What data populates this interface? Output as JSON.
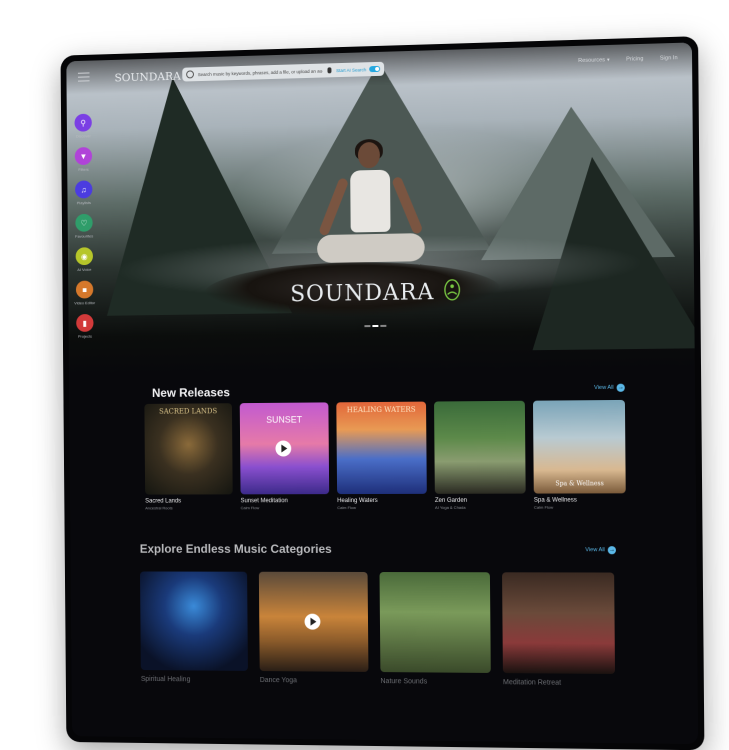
{
  "brand": {
    "name": "SOUNDARA"
  },
  "search": {
    "placeholder": "Search music by keywords, phrases, add a file, or upload an audio file",
    "ai_label": "Start AI Search"
  },
  "nav": {
    "resources": "Resources",
    "pricing": "Pricing",
    "sign_in": "Sign In"
  },
  "sidebar": {
    "items": [
      {
        "label": "Discover",
        "icon": "search-icon",
        "color": "#7b3fe4"
      },
      {
        "label": "Filters",
        "icon": "filter-icon",
        "color": "#b043d8"
      },
      {
        "label": "Playlists",
        "icon": "music-note-icon",
        "color": "#4b3ce0"
      },
      {
        "label": "Favourites",
        "icon": "heart-icon",
        "color": "#2f9d6a"
      },
      {
        "label": "AI Voice",
        "icon": "ai-voice-icon",
        "color": "#b6c62a"
      },
      {
        "label": "Video Editor",
        "icon": "video-editor-icon",
        "color": "#d5782b"
      },
      {
        "label": "Projects",
        "icon": "folder-icon",
        "color": "#d23a3a"
      }
    ]
  },
  "hero": {
    "logo_text": "SOUNDARA"
  },
  "new_releases": {
    "title": "New Releases",
    "view_all": "View All",
    "items": [
      {
        "title": "Sacred Lands",
        "subtitle": "Ancestral Roots",
        "art_text": "SACRED LANDS"
      },
      {
        "title": "Sunset Meditation",
        "subtitle": "Calm Flow",
        "art_text": "SUNSET"
      },
      {
        "title": "Healing Waters",
        "subtitle": "Calm Flow",
        "art_text": "HEALING WATERS"
      },
      {
        "title": "Zen Garden",
        "subtitle": "AI Yoga & Chada",
        "art_text": ""
      },
      {
        "title": "Spa & Wellness",
        "subtitle": "Calm Flow",
        "art_text": "Spa & Wellness"
      }
    ]
  },
  "categories": {
    "title": "Explore Endless Music Categories",
    "view_all": "View All",
    "items": [
      {
        "title": "Spiritual Healing"
      },
      {
        "title": "Dance Yoga"
      },
      {
        "title": "Nature Sounds"
      },
      {
        "title": "Meditation Retreat"
      }
    ]
  }
}
